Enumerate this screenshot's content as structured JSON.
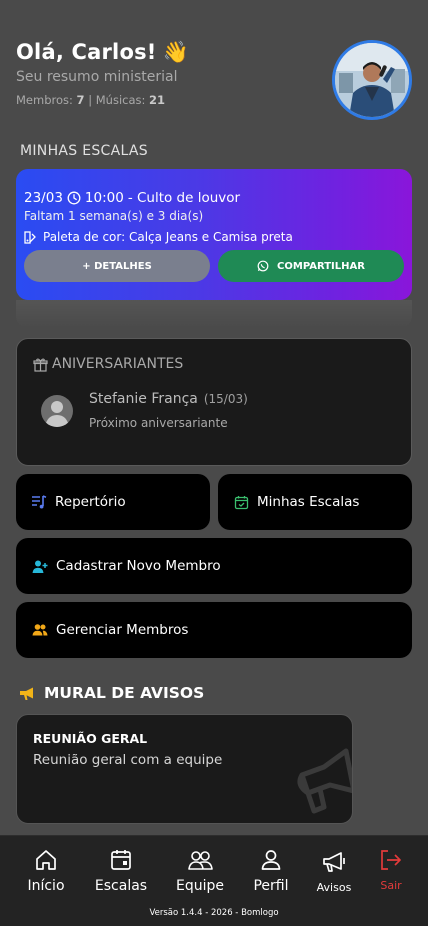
{
  "header": {
    "greeting": "Olá, Carlos!",
    "wave_emoji": "👋",
    "subtitle": "Seu resumo ministerial",
    "members_label": "Membros:",
    "members_count": "7",
    "separator": "|",
    "songs_label": "Músicas:",
    "songs_count": "21"
  },
  "schedules": {
    "title": "MINHAS ESCALAS",
    "date": "23/03",
    "time": "10:00",
    "event": "- Culto de louvor",
    "remaining": "Faltam 1 semana(s) e 3 dia(s)",
    "palette": "Paleta de cor: Calça Jeans e Camisa preta",
    "details_button": "+ DETALHES",
    "share_button": "COMPARTILHAR"
  },
  "birthdays": {
    "title": "ANIVERSARIANTES",
    "name": "Stefanie França",
    "date": "(15/03)",
    "note": "Próximo aniversariante"
  },
  "actions": {
    "repertoire": "Repertório",
    "my_schedules": "Minhas Escalas",
    "new_member": "Cadastrar Novo Membro",
    "manage_members": "Gerenciar Membros"
  },
  "mural": {
    "title": "MURAL DE AVISOS",
    "notice_title": "REUNIÃO GERAL",
    "notice_body": "Reunião geral com a equipe"
  },
  "nav": {
    "home": "Início",
    "schedules": "Escalas",
    "team": "Equipe",
    "profile": "Perfil",
    "notices": "Avisos",
    "logout": "Sair",
    "version": "Versão 1.4.4 - 2026 - Bomlogo"
  },
  "colors": {
    "accent_blue": "#2f7be6",
    "share_green": "#1f8a55",
    "logout_red": "#e23b3b",
    "megaphone_yellow": "#f2b418"
  }
}
